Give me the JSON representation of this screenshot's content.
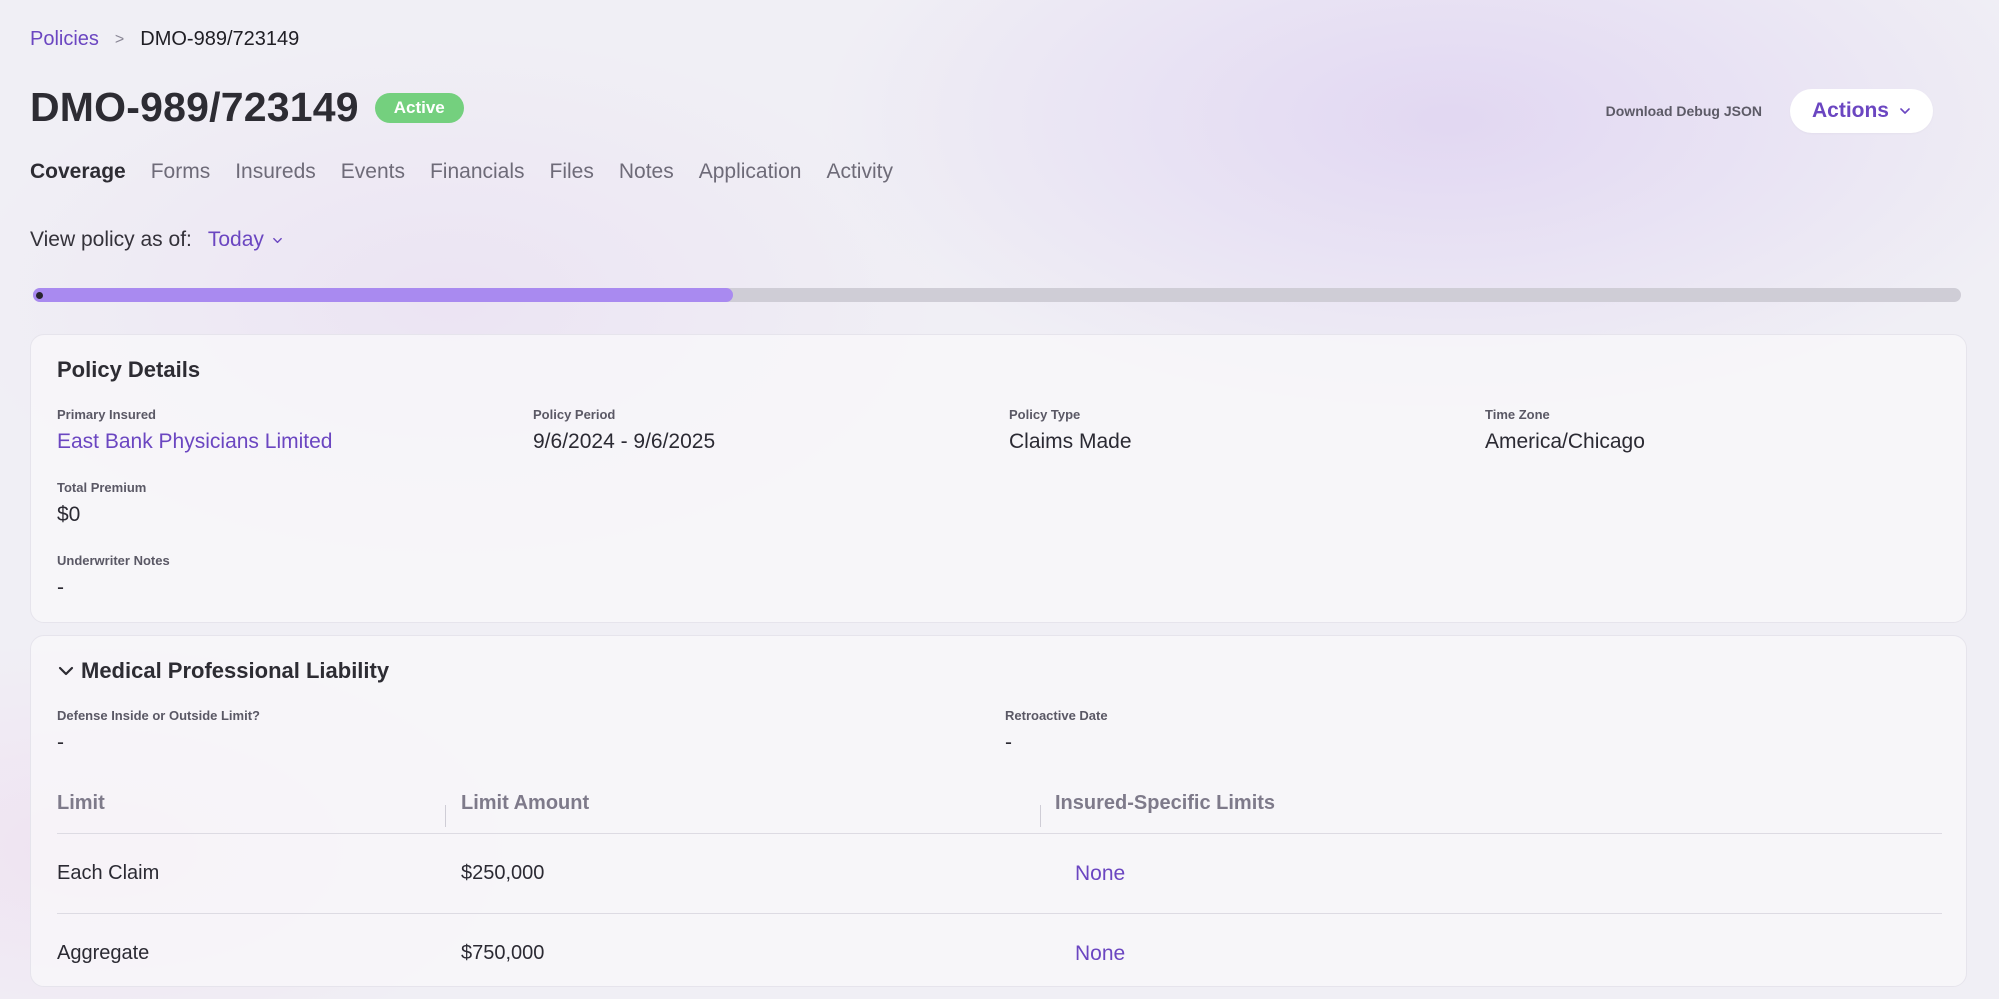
{
  "breadcrumb": {
    "parent": "Policies",
    "separator": ">",
    "current": "DMO-989/723149"
  },
  "header": {
    "title": "DMO-989/723149",
    "status": "Active",
    "debug_link": "Download Debug JSON",
    "actions_label": "Actions"
  },
  "tabs": [
    {
      "label": "Coverage",
      "active": true
    },
    {
      "label": "Forms"
    },
    {
      "label": "Insureds"
    },
    {
      "label": "Events"
    },
    {
      "label": "Financials"
    },
    {
      "label": "Files"
    },
    {
      "label": "Notes"
    },
    {
      "label": "Application"
    },
    {
      "label": "Activity"
    }
  ],
  "view_as_of": {
    "label": "View policy as of:",
    "value": "Today"
  },
  "progress": {
    "fraction": 0.363
  },
  "policy_details": {
    "title": "Policy Details",
    "primary_insured": {
      "label": "Primary Insured",
      "value": "East Bank Physicians Limited"
    },
    "policy_period": {
      "label": "Policy Period",
      "value": "9/6/2024 - 9/6/2025"
    },
    "policy_type": {
      "label": "Policy Type",
      "value": "Claims Made"
    },
    "time_zone": {
      "label": "Time Zone",
      "value": "America/Chicago"
    },
    "total_premium": {
      "label": "Total Premium",
      "value": "$0"
    },
    "underwriter_notes": {
      "label": "Underwriter Notes",
      "value": "-"
    }
  },
  "mpl": {
    "title": "Medical Professional Liability",
    "defense": {
      "label": "Defense Inside or Outside Limit?",
      "value": "-"
    },
    "retro": {
      "label": "Retroactive Date",
      "value": "-"
    },
    "columns": [
      "Limit",
      "Limit Amount",
      "Insured-Specific Limits"
    ],
    "rows": [
      {
        "limit": "Each Claim",
        "amount": "$250,000",
        "specific": "None"
      },
      {
        "limit": "Aggregate",
        "amount": "$750,000",
        "specific": "None"
      }
    ]
  },
  "colors": {
    "accent": "#6b46c1",
    "badge": "#74d07e",
    "progress_fill": "#a98af0"
  }
}
